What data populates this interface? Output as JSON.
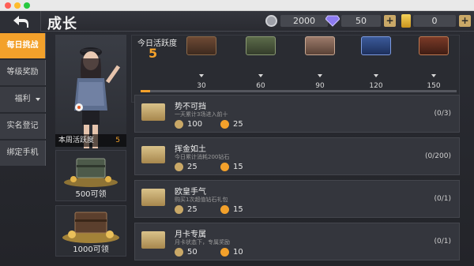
{
  "header": {
    "title": "成长"
  },
  "currency": [
    {
      "icon": "coin-icon",
      "value": "2000",
      "has_plus": false
    },
    {
      "icon": "diamond-icon",
      "value": "50",
      "has_plus": true
    },
    {
      "icon": "gold-bar-icon",
      "value": "0",
      "has_plus": true
    }
  ],
  "sidebar": {
    "items": [
      {
        "label": "每日挑战",
        "active": true
      },
      {
        "label": "等级奖励"
      },
      {
        "label": "福利",
        "dropdown": true
      },
      {
        "label": "实名登记"
      },
      {
        "label": "绑定手机"
      }
    ]
  },
  "character": {
    "weekly_label": "本周活跃度",
    "weekly_value": "5"
  },
  "weekly_rewards": [
    {
      "label": "500可领"
    },
    {
      "label": "1000可领"
    }
  ],
  "daily": {
    "label": "今日活跃度",
    "value": "5",
    "progress": 0.03,
    "milestones": [
      "30",
      "60",
      "90",
      "120",
      "150"
    ]
  },
  "tasks": [
    {
      "title": "势不可挡",
      "desc": "一天累计3场进入前十",
      "reward1": "100",
      "reward2": "25",
      "progress": "(0/3)"
    },
    {
      "title": "挥金如土",
      "desc": "今日累计消耗200钻石",
      "reward1": "25",
      "reward2": "15",
      "progress": "(0/200)"
    },
    {
      "title": "欧皇手气",
      "desc": "购买1次超值钻石礼包",
      "reward1": "25",
      "reward2": "15",
      "progress": "(0/1)"
    },
    {
      "title": "月卡专属",
      "desc": "月卡状态下，专属奖励",
      "reward1": "50",
      "reward2": "10",
      "progress": "(0/1)"
    }
  ],
  "colors": {
    "accent": "#f3a12b",
    "panel": "#34363d",
    "plus": "#c9a867"
  }
}
